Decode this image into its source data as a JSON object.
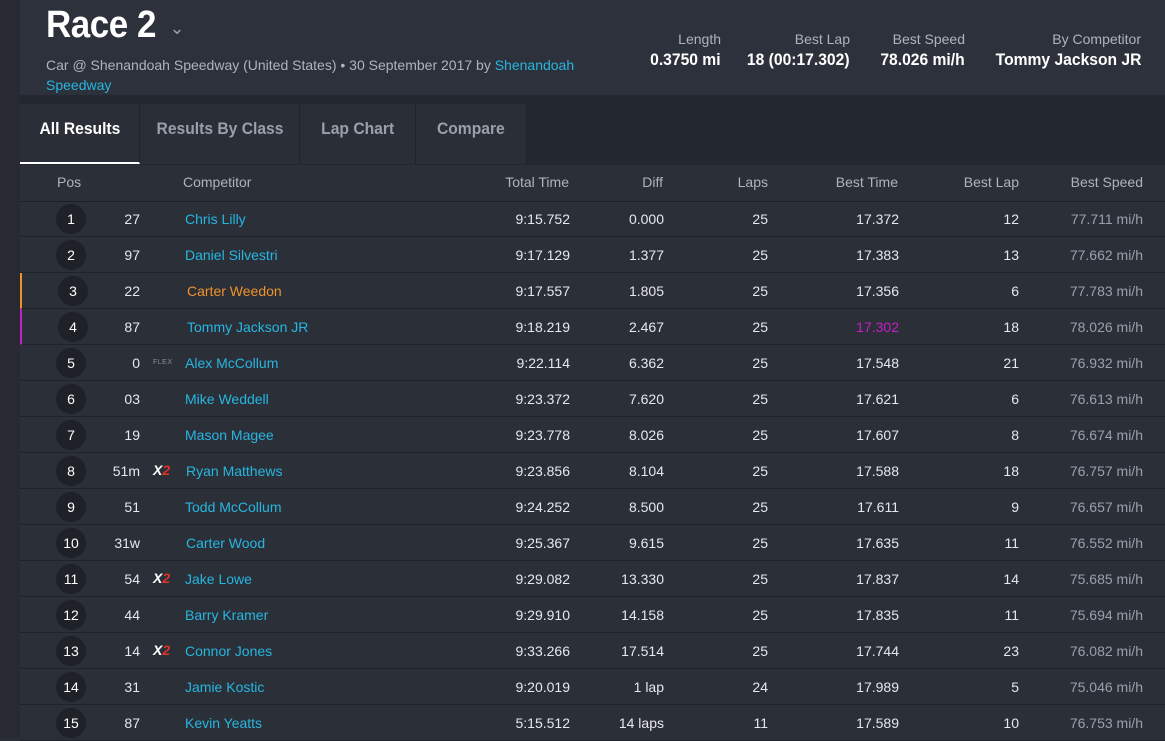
{
  "race": {
    "title": "Race 2",
    "subtitle_text": "Car @ Shenandoah Speedway (United States) • 30 September 2017 by ",
    "subtitle_link": "Shenandoah Speedway"
  },
  "stats": [
    {
      "label": "Length",
      "value": "0.3750 mi"
    },
    {
      "label": "Best Lap",
      "value": "18 (00:17.302)"
    },
    {
      "label": "Best Speed",
      "value": "78.026 mi/h"
    },
    {
      "label": "By Competitor",
      "value": "Tommy Jackson JR"
    }
  ],
  "tabs": [
    "All Results",
    "Results By Class",
    "Lap Chart",
    "Compare"
  ],
  "columns": {
    "pos": "Pos",
    "competitor": "Competitor",
    "total_time": "Total Time",
    "diff": "Diff",
    "laps": "Laps",
    "best_time": "Best Time",
    "best_lap": "Best Lap",
    "best_speed": "Best Speed"
  },
  "badges": {
    "x": "X",
    "two": "2",
    "flex": "FLEX"
  },
  "colors": {
    "accent": "#27b6e0",
    "orange": "#f0922b",
    "magenta": "#c81ec8",
    "x2_red": "#e0302a"
  },
  "rows": [
    {
      "pos": "1",
      "number": "27",
      "name": "Chris Lilly",
      "total": "9:15.752",
      "diff": "0.000",
      "laps": "25",
      "best_time": "17.372",
      "best_lap": "12",
      "best_speed": "77.711 mi/h"
    },
    {
      "pos": "2",
      "number": "97",
      "name": "Daniel Silvestri",
      "total": "9:17.129",
      "diff": "1.377",
      "laps": "25",
      "best_time": "17.383",
      "best_lap": "13",
      "best_speed": "77.662 mi/h"
    },
    {
      "pos": "3",
      "number": "22",
      "name": "Carter Weedon",
      "total": "9:17.557",
      "diff": "1.805",
      "laps": "25",
      "best_time": "17.356",
      "best_lap": "6",
      "best_speed": "77.783 mi/h"
    },
    {
      "pos": "4",
      "number": "87",
      "name": "Tommy Jackson JR",
      "total": "9:18.219",
      "diff": "2.467",
      "laps": "25",
      "best_time": "17.302",
      "best_lap": "18",
      "best_speed": "78.026 mi/h"
    },
    {
      "pos": "5",
      "number": "0",
      "name": "Alex McCollum",
      "total": "9:22.114",
      "diff": "6.362",
      "laps": "25",
      "best_time": "17.548",
      "best_lap": "21",
      "best_speed": "76.932 mi/h"
    },
    {
      "pos": "6",
      "number": "03",
      "name": "Mike Weddell",
      "total": "9:23.372",
      "diff": "7.620",
      "laps": "25",
      "best_time": "17.621",
      "best_lap": "6",
      "best_speed": "76.613 mi/h"
    },
    {
      "pos": "7",
      "number": "19",
      "name": "Mason Magee",
      "total": "9:23.778",
      "diff": "8.026",
      "laps": "25",
      "best_time": "17.607",
      "best_lap": "8",
      "best_speed": "76.674 mi/h"
    },
    {
      "pos": "8",
      "number": "51m",
      "name": "Ryan Matthews",
      "total": "9:23.856",
      "diff": "8.104",
      "laps": "25",
      "best_time": "17.588",
      "best_lap": "18",
      "best_speed": "76.757 mi/h"
    },
    {
      "pos": "9",
      "number": "51",
      "name": "Todd McCollum",
      "total": "9:24.252",
      "diff": "8.500",
      "laps": "25",
      "best_time": "17.611",
      "best_lap": "9",
      "best_speed": "76.657 mi/h"
    },
    {
      "pos": "10",
      "number": "31w",
      "name": "Carter Wood",
      "total": "9:25.367",
      "diff": "9.615",
      "laps": "25",
      "best_time": "17.635",
      "best_lap": "11",
      "best_speed": "76.552 mi/h"
    },
    {
      "pos": "11",
      "number": "54",
      "name": "Jake Lowe",
      "total": "9:29.082",
      "diff": "13.330",
      "laps": "25",
      "best_time": "17.837",
      "best_lap": "14",
      "best_speed": "75.685 mi/h"
    },
    {
      "pos": "12",
      "number": "44",
      "name": "Barry Kramer",
      "total": "9:29.910",
      "diff": "14.158",
      "laps": "25",
      "best_time": "17.835",
      "best_lap": "11",
      "best_speed": "75.694 mi/h"
    },
    {
      "pos": "13",
      "number": "14",
      "name": "Connor Jones",
      "total": "9:33.266",
      "diff": "17.514",
      "laps": "25",
      "best_time": "17.744",
      "best_lap": "23",
      "best_speed": "76.082 mi/h"
    },
    {
      "pos": "14",
      "number": "31",
      "name": "Jamie Kostic",
      "total": "9:20.019",
      "diff": "1 lap",
      "laps": "24",
      "best_time": "17.989",
      "best_lap": "5",
      "best_speed": "75.046 mi/h"
    },
    {
      "pos": "15",
      "number": "87",
      "name": "Kevin Yeatts",
      "total": "5:15.512",
      "diff": "14 laps",
      "laps": "11",
      "best_time": "17.589",
      "best_lap": "10",
      "best_speed": "76.753 mi/h"
    }
  ]
}
